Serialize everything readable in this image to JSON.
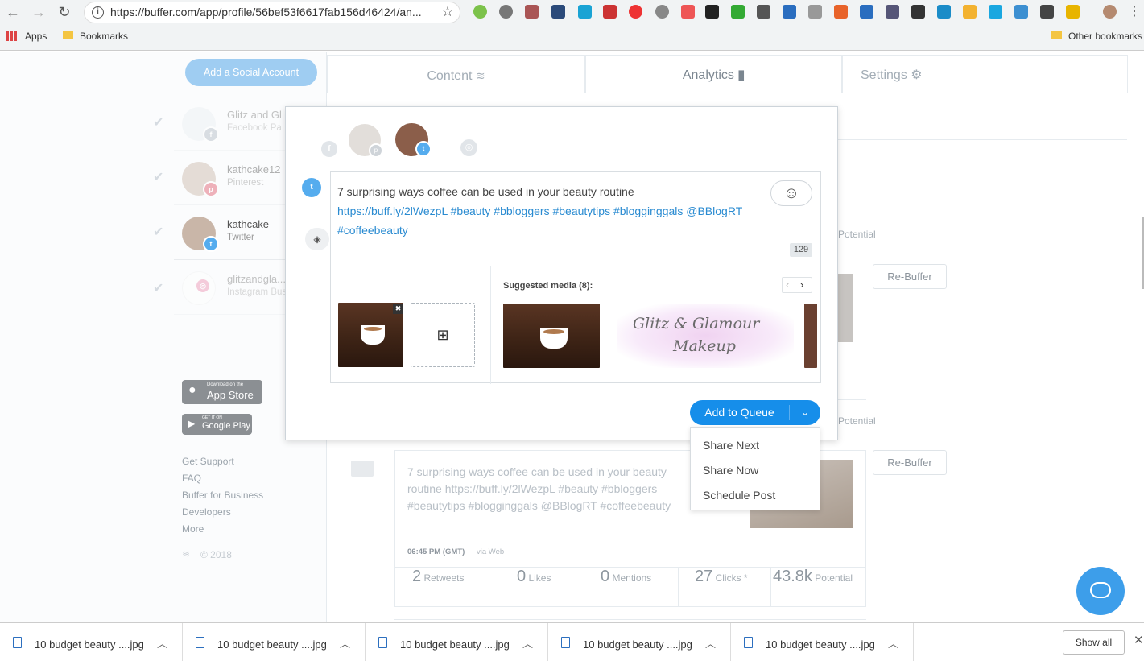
{
  "browser": {
    "url": "https://buffer.com/app/profile/56bef53f6617fab156d46424/an...",
    "bookmarks": {
      "apps": "Apps",
      "bookmarks": "Bookmarks",
      "other": "Other bookmarks"
    }
  },
  "sidebar": {
    "add_account": "Add a Social Account",
    "accounts": [
      {
        "name": "Glitz and Gl",
        "network": "Facebook Pa"
      },
      {
        "name": "kathcake12",
        "network": "Pinterest"
      },
      {
        "name": "kathcake",
        "network": "Twitter"
      },
      {
        "name": "glitzandgla...",
        "network": "Instagram Bus"
      }
    ],
    "appstore_small": "Download on the",
    "appstore": "App Store",
    "googleplay_small": "GET IT ON",
    "googleplay": "Google Play",
    "footer": [
      "Get Support",
      "FAQ",
      "Buffer for Business",
      "Developers",
      "More"
    ],
    "copyright": "© 2018"
  },
  "tabs": [
    {
      "label": "Content"
    },
    {
      "label": "Analytics"
    },
    {
      "label": "Settings"
    }
  ],
  "composer": {
    "text": "7 surprising ways coffee can be used in your beauty routine",
    "link": "https://buff.ly/2lWezpL #beauty #bbloggers #beautytips #blogginggals @BBlogRT #coffeebeauty",
    "char_count": "129",
    "suggested_label": "Suggested media (8):",
    "add_to_queue": "Add to Queue",
    "dropdown": [
      "Share Next",
      "Share Now",
      "Schedule Post"
    ],
    "logo_text_1": "Glitz & Glamour",
    "logo_text_2": "Makeup"
  },
  "background_post": {
    "text": "7 surprising ways coffee can be used in your beauty routine https://buff.ly/2lWezpL #beauty #bbloggers #beautytips #blogginggals @BBlogRT #coffeebeauty",
    "time": "06:45 PM (GMT)",
    "via": "via Web",
    "rebuffer": "Re-Buffer",
    "potential": "Potential",
    "stats": [
      {
        "value": "2",
        "label": "Retweets"
      },
      {
        "value": "0",
        "label": "Likes"
      },
      {
        "value": "0",
        "label": "Mentions"
      },
      {
        "value": "27",
        "label": "Clicks *"
      },
      {
        "value": "43.8k",
        "label": "Potential"
      }
    ]
  },
  "downloads": {
    "files": [
      "10 budget beauty ....jpg",
      "10 budget beauty ....jpg",
      "10 budget beauty ....jpg",
      "10 budget beauty ....jpg",
      "10 budget beauty ....jpg"
    ],
    "show_all": "Show all"
  },
  "colors": {
    "accent": "#168eea",
    "twitter": "#55acee",
    "pinterest": "#e0576a",
    "instagram": "#e8729a"
  }
}
